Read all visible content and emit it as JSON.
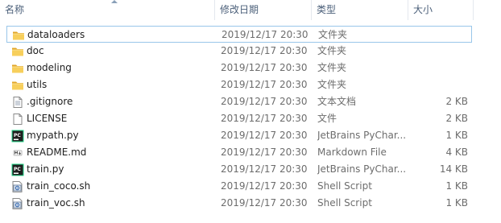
{
  "columns": {
    "name": "名称",
    "date": "修改日期",
    "type": "类型",
    "size": "大小"
  },
  "files": [
    {
      "name": "dataloaders",
      "date": "2019/12/17 20:30",
      "type": "文件夹",
      "size": "",
      "icon": "folder-icon",
      "selected": true
    },
    {
      "name": "doc",
      "date": "2019/12/17 20:30",
      "type": "文件夹",
      "size": "",
      "icon": "folder-icon"
    },
    {
      "name": "modeling",
      "date": "2019/12/17 20:30",
      "type": "文件夹",
      "size": "",
      "icon": "folder-icon"
    },
    {
      "name": "utils",
      "date": "2019/12/17 20:30",
      "type": "文件夹",
      "size": "",
      "icon": "folder-icon"
    },
    {
      "name": ".gitignore",
      "date": "2019/12/17 20:30",
      "type": "文本文档",
      "size": "2 KB",
      "icon": "text-document-icon"
    },
    {
      "name": "LICENSE",
      "date": "2019/12/17 20:30",
      "type": "文件",
      "size": "2 KB",
      "icon": "blank-file-icon"
    },
    {
      "name": "mypath.py",
      "date": "2019/12/17 20:30",
      "type": "JetBrains PyChar...",
      "size": "1 KB",
      "icon": "pycharm-icon"
    },
    {
      "name": "README.md",
      "date": "2019/12/17 20:30",
      "type": "Markdown File",
      "size": "4 KB",
      "icon": "markdown-icon"
    },
    {
      "name": "train.py",
      "date": "2019/12/17 20:30",
      "type": "JetBrains PyChar...",
      "size": "14 KB",
      "icon": "pycharm-icon"
    },
    {
      "name": "train_coco.sh",
      "date": "2019/12/17 20:30",
      "type": "Shell Script",
      "size": "1 KB",
      "icon": "shell-script-icon"
    },
    {
      "name": "train_voc.sh",
      "date": "2019/12/17 20:30",
      "type": "Shell Script",
      "size": "1 KB",
      "icon": "shell-script-icon"
    }
  ],
  "colors": {
    "selection_border": "#99c6ea",
    "header_text": "#4c607a",
    "folder": "#e8b93c"
  }
}
